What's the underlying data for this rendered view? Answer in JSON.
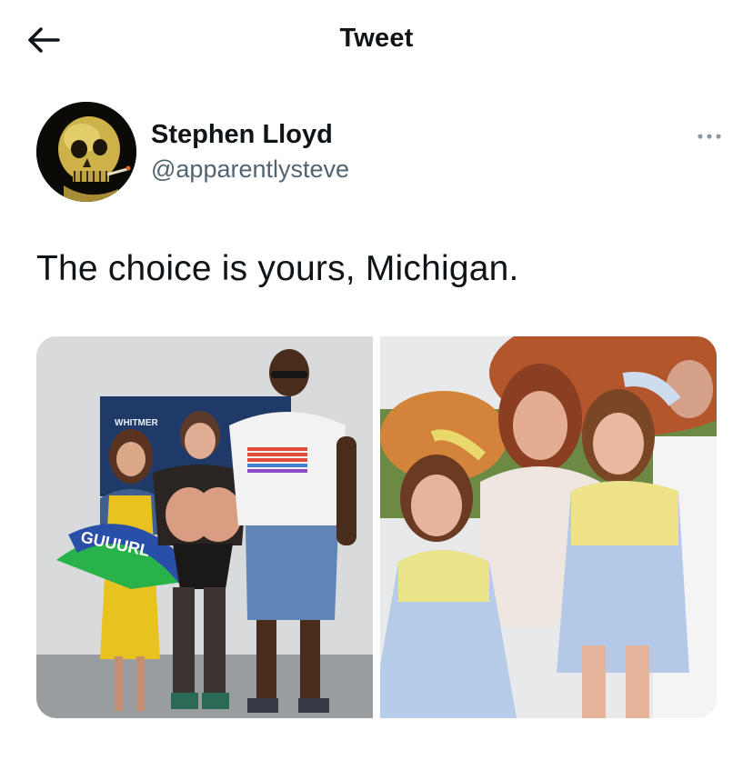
{
  "header": {
    "title": "Tweet"
  },
  "author": {
    "display_name": "Stephen Lloyd",
    "handle": "@apparentlysteve"
  },
  "tweet": {
    "text": "The choice is yours, Michigan."
  },
  "media": {
    "left_photo": {
      "backdrop_text": "WHITMER",
      "fan_text": "GUUURL"
    },
    "right_photo": {}
  },
  "icons": {
    "back": "arrow-left-icon",
    "more": "more-horizontal-icon"
  },
  "colors": {
    "text_primary": "#0f1419",
    "text_secondary": "#536471",
    "background": "#ffffff"
  }
}
